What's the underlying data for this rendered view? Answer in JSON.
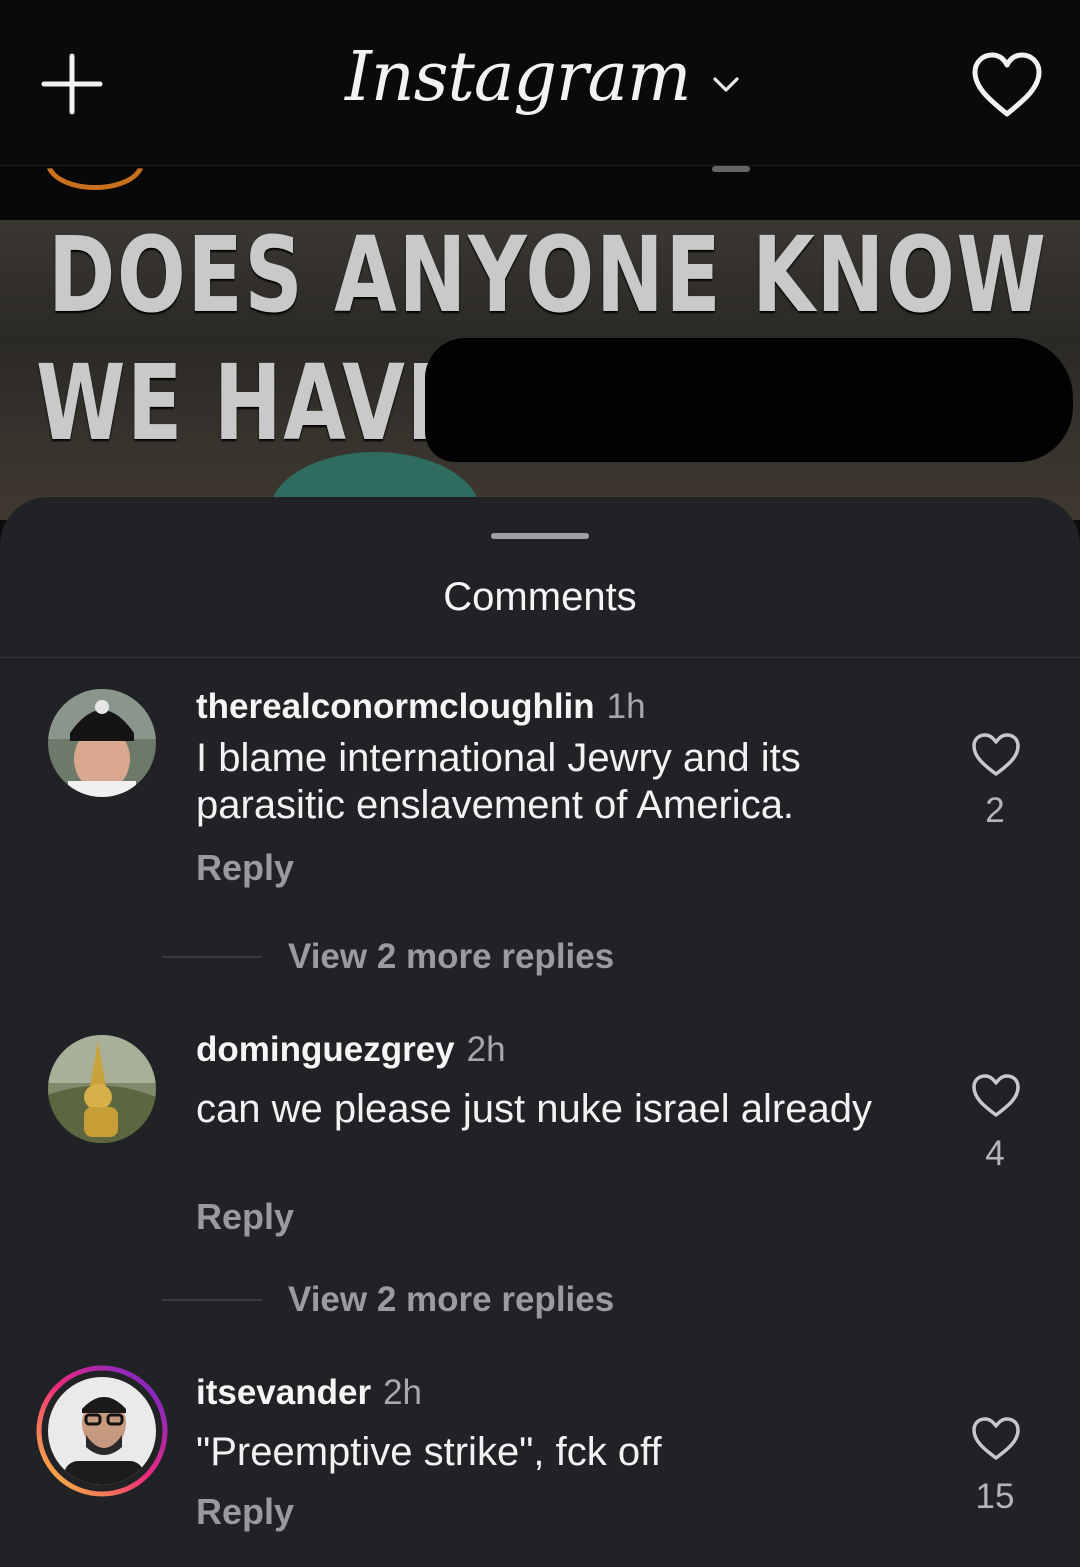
{
  "app": {
    "title": "Instagram"
  },
  "post": {
    "line1": "DOES ANYONE KNOW IF",
    "line2": "WE HAVE"
  },
  "sheet": {
    "title": "Comments"
  },
  "comments": [
    {
      "username": "therealconormcloughlin",
      "time": "1h",
      "text": "I blame international Jewry and its parasitic enslavement of America.",
      "reply_label": "Reply",
      "likes": "2",
      "more_replies": "View 2 more replies"
    },
    {
      "username": "dominguezgrey",
      "time": "2h",
      "text": "can we please just nuke israel already",
      "reply_label": "Reply",
      "likes": "4",
      "more_replies": "View 2 more replies"
    },
    {
      "username": "itsevander",
      "time": "2h",
      "text": "\"Preemptive strike\", fck off",
      "reply_label": "Reply",
      "likes": "15"
    }
  ],
  "icons": {
    "new_post": "plus-icon",
    "switch_feed": "chevron-down-icon",
    "activity": "heart-icon",
    "like": "heart-outline-icon"
  },
  "colors": {
    "sheet_bg": "#212226",
    "topbar_bg": "#0a0a0a",
    "story_ring_start": "#f9ce34",
    "story_ring_mid": "#ee2a7b",
    "story_ring_end": "#6228d7"
  }
}
